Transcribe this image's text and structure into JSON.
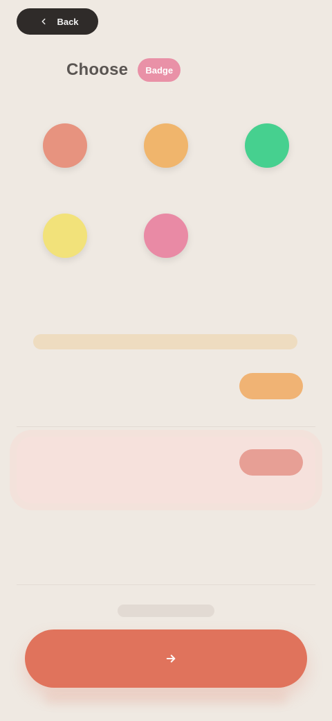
{
  "top_pill": {
    "label": "Back"
  },
  "header": {
    "title": "Choose",
    "badge": "Badge",
    "subtitle": ""
  },
  "grid": {
    "items": [
      {
        "label": "",
        "color": "#e7937f"
      },
      {
        "label": "",
        "color": "#f0b56c"
      },
      {
        "label": "",
        "color": "#46d08f"
      },
      {
        "label": "",
        "color": "#f2e27a"
      },
      {
        "label": "",
        "color": "#e98aa5"
      }
    ]
  },
  "divider": {
    "label": ""
  },
  "cards": [
    {
      "desc": "",
      "value": "",
      "unit": "",
      "button": ""
    },
    {
      "desc": "",
      "value": "",
      "unit": "",
      "button": ""
    },
    {
      "desc": "",
      "value": "",
      "unit": ""
    }
  ],
  "footer": {
    "mini_label": "",
    "cta_label": ""
  },
  "colors": {
    "background": "#efe9e2",
    "accent": "#e0735c",
    "alert_bg": "#f6e1dc",
    "orange": "#f0b374",
    "red": "#e79f95",
    "pink": "#e991a7",
    "dark": "#2f2b29"
  },
  "icons": {
    "back": "chevron-left-icon",
    "cta": "arrow-right-icon"
  }
}
